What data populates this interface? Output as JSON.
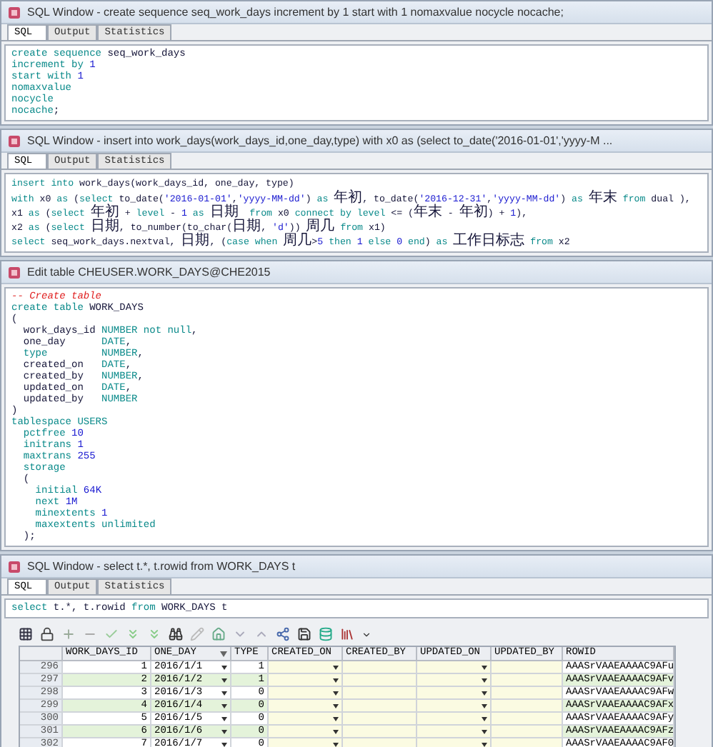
{
  "windows": [
    {
      "title": "SQL Window - create sequence seq_work_days increment by 1 start with 1 nomaxvalue nocycle nocache;",
      "tabs": [
        {
          "label": "SQL",
          "selected": true
        },
        {
          "label": "Output",
          "selected": false
        },
        {
          "label": "Statistics",
          "selected": false
        }
      ],
      "lines": [
        [
          {
            "kind": "kw",
            "text": "create sequence "
          },
          {
            "kind": "plain",
            "text": "seq_work_days"
          }
        ],
        [
          {
            "kind": "kw",
            "text": "increment by "
          },
          {
            "kind": "num",
            "text": "1"
          }
        ],
        [
          {
            "kind": "kw",
            "text": "start with "
          },
          {
            "kind": "num",
            "text": "1"
          }
        ],
        [
          {
            "kind": "kw",
            "text": "nomaxvalue"
          }
        ],
        [
          {
            "kind": "kw",
            "text": "nocycle"
          }
        ],
        [
          {
            "kind": "kw",
            "text": "nocache"
          },
          {
            "kind": "plain",
            "text": ";"
          }
        ]
      ]
    },
    {
      "title": "SQL Window - insert into work_days(work_days_id,one_day,type) with x0 as (select to_date('2016-01-01','yyyy-M ...",
      "tabs": [
        {
          "label": "SQL",
          "selected": true
        },
        {
          "label": "Output",
          "selected": false
        },
        {
          "label": "Statistics",
          "selected": false
        }
      ],
      "lines": [
        [
          {
            "kind": "kw",
            "text": "insert into "
          },
          {
            "kind": "plain",
            "text": "work_days(work_days_id, one_day, type)"
          }
        ],
        [
          {
            "kind": "kw",
            "text": "with "
          },
          {
            "kind": "plain",
            "text": "x0 "
          },
          {
            "kind": "kw",
            "text": "as "
          },
          {
            "kind": "plain",
            "text": "("
          },
          {
            "kind": "kw",
            "text": "select "
          },
          {
            "kind": "plain",
            "text": "to_date("
          },
          {
            "kind": "str",
            "text": "'2016-01-01'"
          },
          {
            "kind": "plain",
            "text": ","
          },
          {
            "kind": "str",
            "text": "'yyyy-MM-dd'"
          },
          {
            "kind": "plain",
            "text": ") "
          },
          {
            "kind": "kw",
            "text": "as "
          },
          {
            "kind": "cjk",
            "text": "年初"
          },
          {
            "kind": "plain",
            "text": ", to_date("
          },
          {
            "kind": "str",
            "text": "'2016-12-31'"
          },
          {
            "kind": "plain",
            "text": ","
          },
          {
            "kind": "str",
            "text": "'yyyy-MM-dd'"
          },
          {
            "kind": "plain",
            "text": ") "
          },
          {
            "kind": "kw",
            "text": "as "
          },
          {
            "kind": "cjk",
            "text": "年末"
          },
          {
            "kind": "kw",
            "text": " from "
          },
          {
            "kind": "plain",
            "text": "dual ),"
          }
        ],
        [
          {
            "kind": "plain",
            "text": "x1 "
          },
          {
            "kind": "kw",
            "text": "as "
          },
          {
            "kind": "plain",
            "text": "("
          },
          {
            "kind": "kw",
            "text": "select "
          },
          {
            "kind": "cjk",
            "text": "年初"
          },
          {
            "kind": "plain",
            "text": " + "
          },
          {
            "kind": "kw",
            "text": "level "
          },
          {
            "kind": "plain",
            "text": "- "
          },
          {
            "kind": "num",
            "text": "1"
          },
          {
            "kind": "kw",
            "text": " as "
          },
          {
            "kind": "cjk",
            "text": "日期"
          },
          {
            "kind": "kw",
            "text": "  from "
          },
          {
            "kind": "plain",
            "text": "x0 "
          },
          {
            "kind": "kw",
            "text": "connect by level "
          },
          {
            "kind": "plain",
            "text": "<= ("
          },
          {
            "kind": "cjk",
            "text": "年末"
          },
          {
            "kind": "plain",
            "text": " - "
          },
          {
            "kind": "cjk",
            "text": "年初"
          },
          {
            "kind": "plain",
            "text": ") + "
          },
          {
            "kind": "num",
            "text": "1"
          },
          {
            "kind": "plain",
            "text": "),"
          }
        ],
        [
          {
            "kind": "plain",
            "text": "x2 "
          },
          {
            "kind": "kw",
            "text": "as "
          },
          {
            "kind": "plain",
            "text": "("
          },
          {
            "kind": "kw",
            "text": "select "
          },
          {
            "kind": "cjk",
            "text": "日期"
          },
          {
            "kind": "plain",
            "text": ", to_number(to_char("
          },
          {
            "kind": "cjk",
            "text": "日期"
          },
          {
            "kind": "plain",
            "text": ", "
          },
          {
            "kind": "str",
            "text": "'d'"
          },
          {
            "kind": "plain",
            "text": ")) "
          },
          {
            "kind": "cjk",
            "text": "周几"
          },
          {
            "kind": "kw",
            "text": " from "
          },
          {
            "kind": "plain",
            "text": "x1)"
          }
        ],
        [
          {
            "kind": "kw",
            "text": "select "
          },
          {
            "kind": "plain",
            "text": "seq_work_days.nextval, "
          },
          {
            "kind": "cjk",
            "text": "日期"
          },
          {
            "kind": "plain",
            "text": ", ("
          },
          {
            "kind": "kw",
            "text": "case when "
          },
          {
            "kind": "cjk",
            "text": "周几"
          },
          {
            "kind": "plain",
            "text": ">"
          },
          {
            "kind": "num",
            "text": "5"
          },
          {
            "kind": "kw",
            "text": " then "
          },
          {
            "kind": "num",
            "text": "1"
          },
          {
            "kind": "kw",
            "text": " else "
          },
          {
            "kind": "num",
            "text": "0"
          },
          {
            "kind": "kw",
            "text": " end"
          },
          {
            "kind": "plain",
            "text": ") "
          },
          {
            "kind": "kw",
            "text": "as "
          },
          {
            "kind": "cjk",
            "text": "工作日标志"
          },
          {
            "kind": "kw",
            "text": " from "
          },
          {
            "kind": "plain",
            "text": "x2"
          }
        ]
      ]
    },
    {
      "title": "Edit table CHEUSER.WORK_DAYS@CHE2015",
      "lines": [
        [
          {
            "kind": "comment",
            "text": "-- Create table"
          }
        ],
        [
          {
            "kind": "kw",
            "text": "create table "
          },
          {
            "kind": "plain",
            "text": "WORK_DAYS"
          }
        ],
        [
          {
            "kind": "plain",
            "text": "("
          }
        ],
        [
          {
            "kind": "plain",
            "text": "  work_days_id "
          },
          {
            "kind": "kw",
            "text": "NUMBER not null"
          },
          {
            "kind": "plain",
            "text": ","
          }
        ],
        [
          {
            "kind": "plain",
            "text": "  one_day      "
          },
          {
            "kind": "kw",
            "text": "DATE"
          },
          {
            "kind": "plain",
            "text": ","
          }
        ],
        [
          {
            "kind": "kw",
            "text": "  type         NUMBER"
          },
          {
            "kind": "plain",
            "text": ","
          }
        ],
        [
          {
            "kind": "plain",
            "text": "  created_on   "
          },
          {
            "kind": "kw",
            "text": "DATE"
          },
          {
            "kind": "plain",
            "text": ","
          }
        ],
        [
          {
            "kind": "plain",
            "text": "  created_by   "
          },
          {
            "kind": "kw",
            "text": "NUMBER"
          },
          {
            "kind": "plain",
            "text": ","
          }
        ],
        [
          {
            "kind": "plain",
            "text": "  updated_on   "
          },
          {
            "kind": "kw",
            "text": "DATE"
          },
          {
            "kind": "plain",
            "text": ","
          }
        ],
        [
          {
            "kind": "plain",
            "text": "  updated_by   "
          },
          {
            "kind": "kw",
            "text": "NUMBER"
          }
        ],
        [
          {
            "kind": "plain",
            "text": ")"
          }
        ],
        [
          {
            "kind": "kw",
            "text": "tablespace USERS"
          }
        ],
        [
          {
            "kind": "kw",
            "text": "  pctfree "
          },
          {
            "kind": "num",
            "text": "10"
          }
        ],
        [
          {
            "kind": "kw",
            "text": "  initrans "
          },
          {
            "kind": "num",
            "text": "1"
          }
        ],
        [
          {
            "kind": "kw",
            "text": "  maxtrans "
          },
          {
            "kind": "num",
            "text": "255"
          }
        ],
        [
          {
            "kind": "kw",
            "text": "  storage"
          }
        ],
        [
          {
            "kind": "plain",
            "text": "  ("
          }
        ],
        [
          {
            "kind": "kw",
            "text": "    initial "
          },
          {
            "kind": "num",
            "text": "64K"
          }
        ],
        [
          {
            "kind": "kw",
            "text": "    next "
          },
          {
            "kind": "num",
            "text": "1M"
          }
        ],
        [
          {
            "kind": "kw",
            "text": "    minextents "
          },
          {
            "kind": "num",
            "text": "1"
          }
        ],
        [
          {
            "kind": "kw",
            "text": "    maxextents unlimited"
          }
        ],
        [
          {
            "kind": "plain",
            "text": "  );"
          }
        ]
      ]
    },
    {
      "title": "SQL Window - select t.*, t.rowid from WORK_DAYS t",
      "tabs": [
        {
          "label": "SQL",
          "selected": true
        },
        {
          "label": "Output",
          "selected": false
        },
        {
          "label": "Statistics",
          "selected": false
        }
      ],
      "lines": [
        [
          {
            "kind": "kw",
            "text": "select "
          },
          {
            "kind": "plain",
            "text": "t.*, t.rowid "
          },
          {
            "kind": "kw",
            "text": "from "
          },
          {
            "kind": "plain",
            "text": "WORK_DAYS t"
          }
        ]
      ],
      "grid": {
        "columns": [
          "WORK_DAYS_ID",
          "ONE_DAY",
          "TYPE",
          "CREATED_ON",
          "CREATED_BY",
          "UPDATED_ON",
          "UPDATED_BY",
          "ROWID"
        ],
        "rows": [
          {
            "row_number": "296",
            "work_days_id": "1",
            "one_day": "2016/1/1",
            "type": "1",
            "rowid": "AAASrVAAEAAAAC9AFu"
          },
          {
            "row_number": "297",
            "work_days_id": "2",
            "one_day": "2016/1/2",
            "type": "1",
            "rowid": "AAASrVAAEAAAAC9AFv"
          },
          {
            "row_number": "298",
            "work_days_id": "3",
            "one_day": "2016/1/3",
            "type": "0",
            "rowid": "AAASrVAAEAAAAC9AFw"
          },
          {
            "row_number": "299",
            "work_days_id": "4",
            "one_day": "2016/1/4",
            "type": "0",
            "rowid": "AAASrVAAEAAAAC9AFx"
          },
          {
            "row_number": "300",
            "work_days_id": "5",
            "one_day": "2016/1/5",
            "type": "0",
            "rowid": "AAASrVAAEAAAAC9AFy"
          },
          {
            "row_number": "301",
            "work_days_id": "6",
            "one_day": "2016/1/6",
            "type": "0",
            "rowid": "AAASrVAAEAAAAC9AFz"
          },
          {
            "row_number": "302",
            "work_days_id": "7",
            "one_day": "2016/1/7",
            "type": "0",
            "rowid": "AAASrVAAEAAAAC9AF0"
          }
        ]
      }
    }
  ]
}
